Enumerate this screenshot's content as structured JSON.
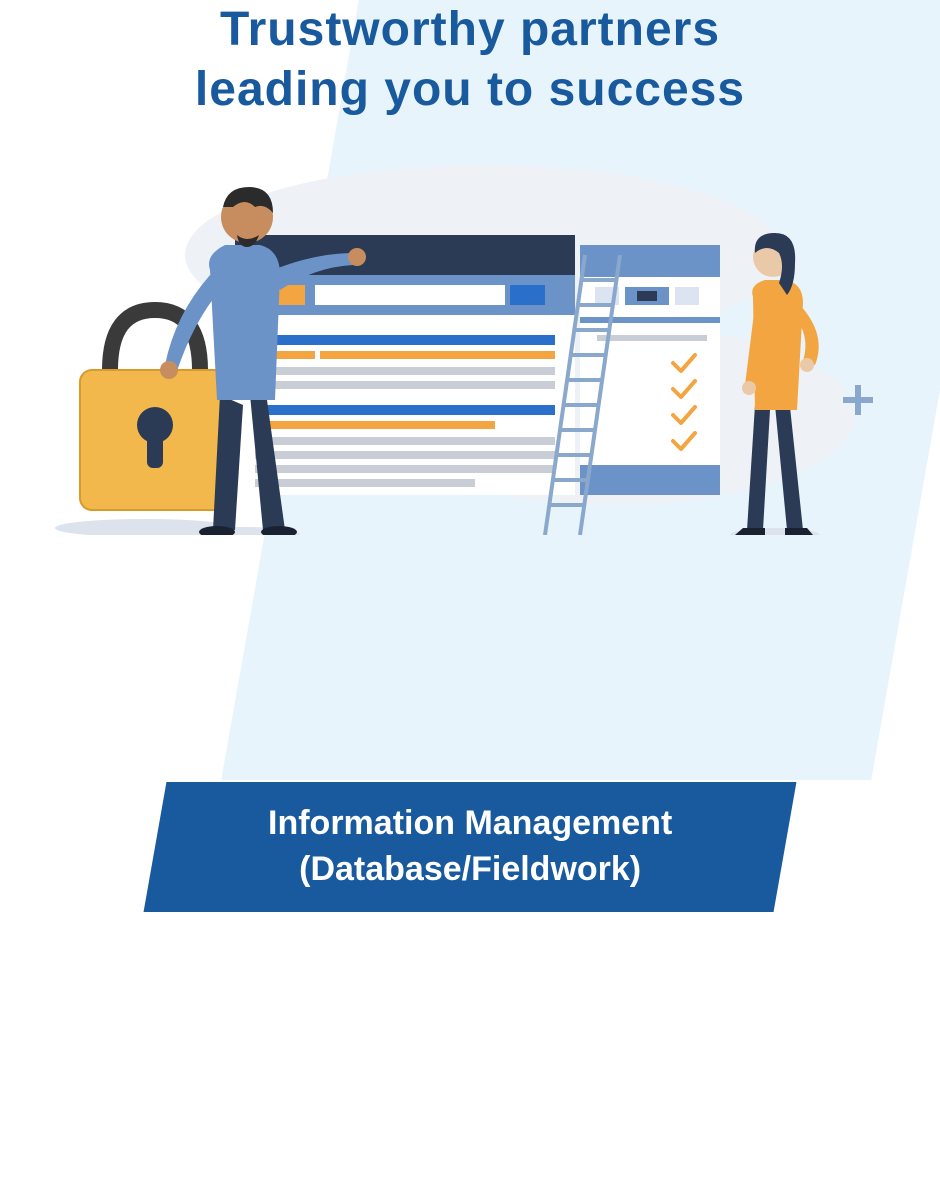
{
  "headline": {
    "line1": "Trustworthy partners",
    "line2": "leading you to success"
  },
  "banner": {
    "line1": "Information Management",
    "line2": "(Database/Fieldwork)"
  },
  "illustration": {
    "description": "Two people beside browser/app mockups with a padlock, ladder, checkmarks and plus symbol",
    "icons": [
      "padlock-icon",
      "browser-window-icon",
      "mobile-panel-icon",
      "ladder-icon",
      "checkmark-icon",
      "plus-icon",
      "person-left-icon",
      "person-right-icon"
    ]
  },
  "colors": {
    "primary": "#185a9d",
    "accent_orange": "#f2a541",
    "accent_blue": "#2a6fc9",
    "light_bg": "#e8f4fc",
    "grey": "#c9ced6",
    "dark_navy": "#2b3a55",
    "skin": "#c88d5e"
  }
}
